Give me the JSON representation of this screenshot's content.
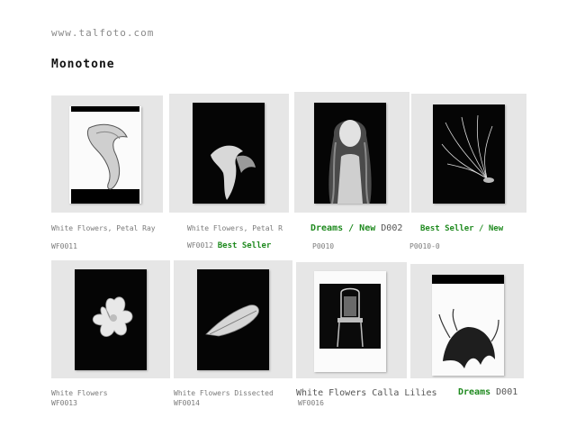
{
  "header": {
    "site": "www.talfoto.com",
    "title": "Monotone"
  },
  "products": [
    {
      "title": "White Flowers, Petal Ray",
      "code": "WF0011"
    },
    {
      "title": "White Flowers, Petal R",
      "code": "WF0012",
      "badge": "Best Seller"
    },
    {
      "title_badge": "Dreams / New",
      "title": "D002",
      "code": "P0010"
    },
    {
      "title_badge": "Best Seller / New",
      "code": "P0010-0"
    },
    {
      "title": "White Flowers",
      "code": "WF0013"
    },
    {
      "title": "White Flowers Dissected",
      "code": "WF0014"
    },
    {
      "title": "White Flowers Calla Lilies",
      "code": "WF0016"
    },
    {
      "title_badge": "Dreams",
      "title": "D001"
    }
  ],
  "colors": {
    "badge": "#1f8a1f",
    "tile": "#e6e6e6"
  }
}
